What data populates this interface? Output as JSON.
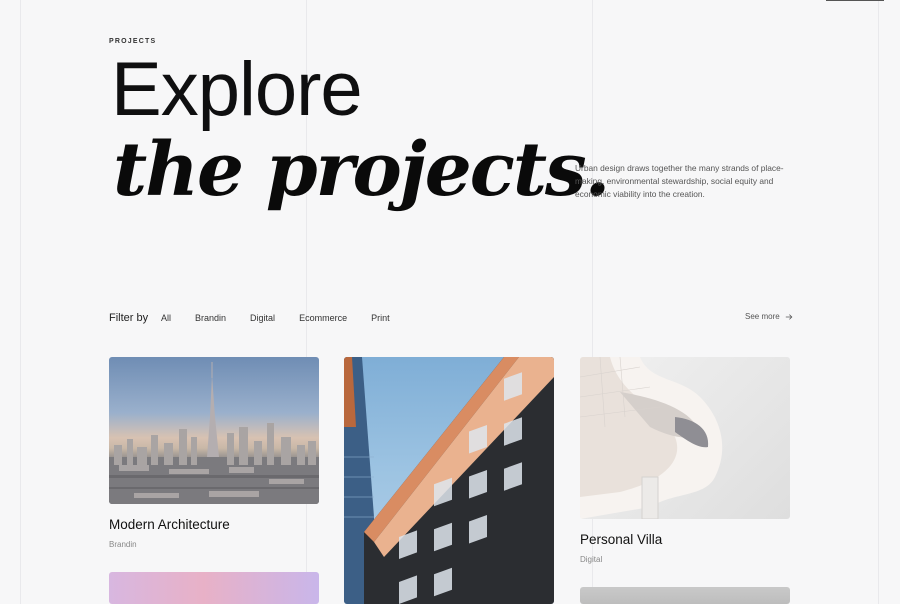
{
  "header": {
    "eyebrow": "PROJECTS",
    "title_line1": "Explore",
    "title_line2": "the projects.",
    "intro": "Urban design draws together the many strands of place-making, environmental stewardship, social equity and economic viability into the creation."
  },
  "filter": {
    "label": "Filter by",
    "items": [
      "All",
      "Brandin",
      "Digital",
      "Ecommerce",
      "Print"
    ],
    "see_more": "See more"
  },
  "projects": [
    {
      "title": "Modern Architecture",
      "category": "Brandin",
      "image": "dubai-skyline"
    },
    {
      "title": "",
      "category": "",
      "image": "tower-facade"
    },
    {
      "title": "Personal Villa",
      "category": "Digital",
      "image": "white-curved-building"
    },
    {
      "title": "",
      "category": "",
      "image": "pastel-sunset"
    },
    {
      "title": "",
      "category": "",
      "image": "grey-building"
    }
  ],
  "colors": {
    "background": "#f7f7f8",
    "text": "#111111",
    "muted": "#888888"
  }
}
